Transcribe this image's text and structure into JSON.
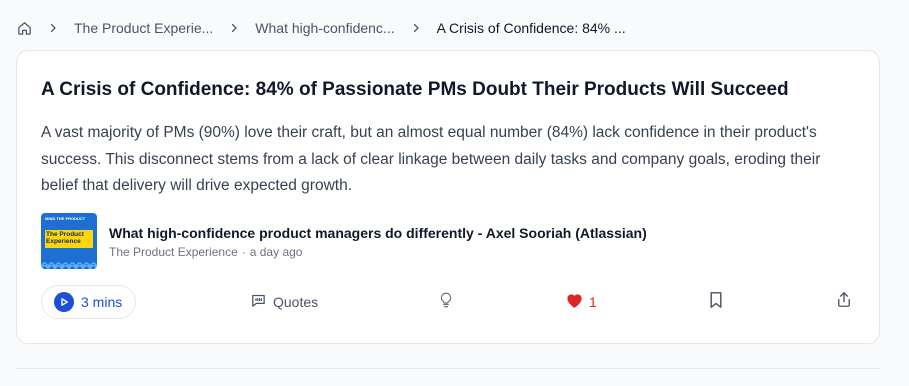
{
  "breadcrumb": {
    "home_icon": "home-icon",
    "items": [
      {
        "label": "The Product Experie..."
      },
      {
        "label": "What high-confidenc..."
      },
      {
        "label": "A Crisis of Confidence: 84% ..."
      }
    ]
  },
  "card": {
    "title": "A Crisis of Confidence: 84% of Passionate PMs Doubt Their Products Will Succeed",
    "summary": "A vast majority of PMs (90%) love their craft, but an almost equal number (84%) lack confidence in their product's success. This disconnect stems from a lack of clear linkage between daily tasks and company goals, eroding their belief that delivery will drive expected growth.",
    "source": {
      "cover_text_top": "MIND THE PRODUCT",
      "cover_text_band": "The Product Experience",
      "title": "What high-confidence product managers do differently - Axel Sooriah (Atlassian)",
      "show": "The Product Experience",
      "separator": "·",
      "time": "a day ago"
    }
  },
  "actions": {
    "play_label": "3 mins",
    "quotes_label": "Quotes",
    "like_count": "1",
    "icons": [
      "play-icon",
      "quotes-icon",
      "lightbulb-icon",
      "heart-icon",
      "bookmark-icon",
      "share-icon"
    ]
  },
  "colors": {
    "accent": "#1d4ed8",
    "heart": "#dc2626",
    "cover_blue": "#1d6fd1",
    "cover_yellow": "#ffd60a"
  }
}
